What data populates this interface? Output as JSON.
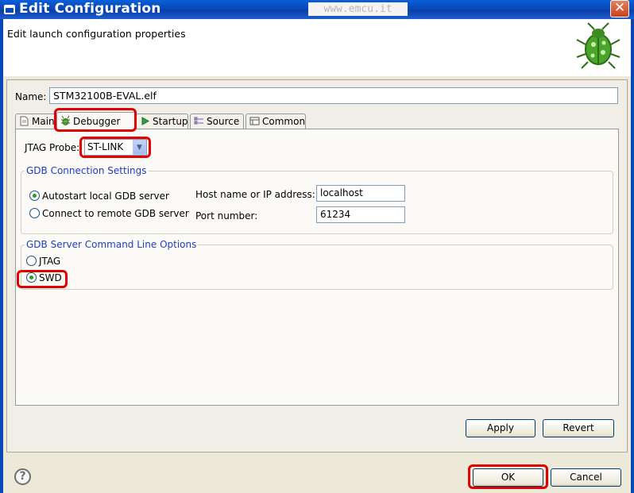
{
  "window": {
    "title": "Edit Configuration",
    "watermark": "www.emcu.it",
    "close_glyph": "✕"
  },
  "banner": {
    "heading": "Edit launch configuration properties",
    "icon": "bug-icon"
  },
  "name": {
    "label": "Name:",
    "value": "STM32100B-EVAL.elf"
  },
  "tabs": [
    {
      "label": "Main",
      "icon": "document-icon",
      "active": false
    },
    {
      "label": "Debugger",
      "icon": "bug-icon",
      "active": true
    },
    {
      "label": "Startup",
      "icon": "play-icon",
      "active": false
    },
    {
      "label": "Source",
      "icon": "source-icon",
      "active": false
    },
    {
      "label": "Common",
      "icon": "common-icon",
      "active": false
    }
  ],
  "debugger": {
    "jtag_probe_label": "JTAG Probe:",
    "jtag_probe_value": "ST-LINK",
    "gdb_connection": {
      "title": "GDB Connection Settings",
      "autostart_label": "Autostart local GDB server",
      "autostart_selected": true,
      "remote_label": "Connect to remote GDB server",
      "remote_selected": false,
      "host_label": "Host name or IP address:",
      "host_value": "localhost",
      "port_label": "Port number:",
      "port_value": "61234"
    },
    "gdb_server_options": {
      "title": "GDB Server Command Line Options",
      "jtag_label": "JTAG",
      "jtag_selected": false,
      "swd_label": "SWD",
      "swd_selected": true
    }
  },
  "buttons": {
    "apply": "Apply",
    "revert": "Revert",
    "ok": "OK",
    "cancel": "Cancel",
    "help": "?"
  },
  "colors": {
    "highlight": "#e00000",
    "titlebar": "#0847b8",
    "group_title": "#1f3ebd"
  }
}
